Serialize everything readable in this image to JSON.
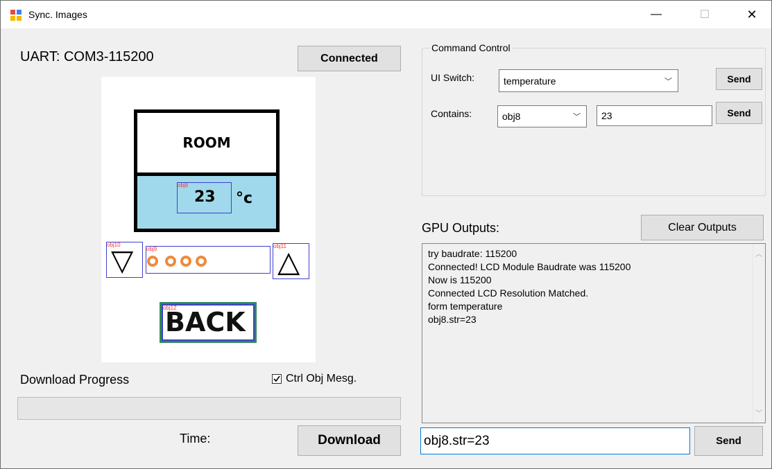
{
  "window": {
    "title": "Sync. Images",
    "controls": {
      "minimize": "—",
      "maximize": "☐",
      "close": "✕"
    }
  },
  "uart": {
    "label": "UART: COM3-115200",
    "connect_button": "Connected"
  },
  "preview": {
    "room_label": "ROOM",
    "temperature_value": "23",
    "unit": "°c",
    "back_label": "BACK",
    "down_arrow": "▽",
    "up_arrow": "△",
    "obj_tags": {
      "obj8": "obj8",
      "obj9": "obj9",
      "obj10": "obj10",
      "obj11": "obj11",
      "obj12": "obj12"
    },
    "colors": {
      "panel_fill": "#9fd9eb",
      "dots": "#f08a3c",
      "back_border_outer": "#2e8b57",
      "back_border_inner": "#3f3fd0"
    }
  },
  "download": {
    "progress_label": "Download Progress",
    "ctrl_checkbox_label": "Ctrl Obj Mesg.",
    "ctrl_checked": true,
    "progress_value": 0,
    "time_label": "Time:",
    "download_button": "Download"
  },
  "command_control": {
    "legend": "Command Control",
    "ui_switch_label": "UI Switch:",
    "ui_switch_value": "temperature",
    "send1": "Send",
    "contains_label": "Contains:",
    "contains_obj": "obj8",
    "contains_value": "23",
    "send2": "Send"
  },
  "gpu": {
    "label": "GPU Outputs:",
    "clear_button": "Clear Outputs",
    "lines": [
      "try baudrate: 115200",
      "Connected! LCD Module Baudrate was 115200",
      "Now is 115200",
      "Connected LCD Resolution Matched.",
      "form temperature",
      "obj8.str=23"
    ],
    "input_value": "obj8.str=23",
    "send_button": "Send"
  }
}
